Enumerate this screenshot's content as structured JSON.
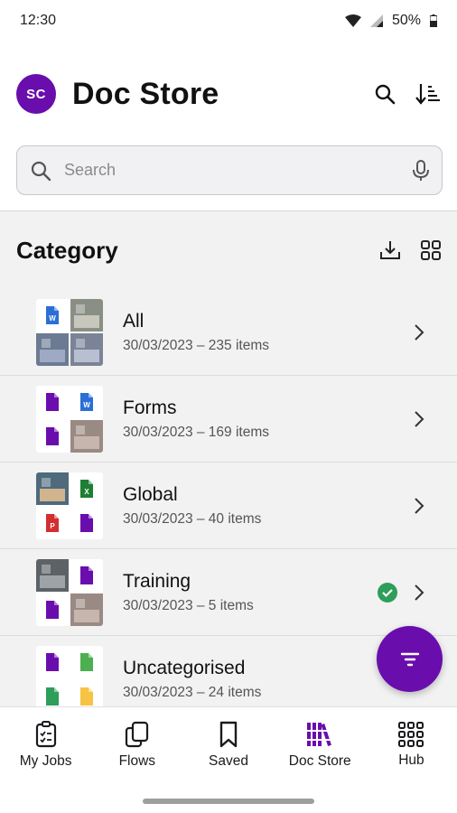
{
  "status_bar": {
    "time": "12:30",
    "battery": "50%"
  },
  "header": {
    "avatar_initials": "SC",
    "title": "Doc Store"
  },
  "search": {
    "placeholder": "Search"
  },
  "section": {
    "title": "Category"
  },
  "categories": [
    {
      "name": "All",
      "meta": "30/03/2023 – 235 items",
      "thumbs": [
        "word",
        "photo-room",
        "photo-office",
        "photo-office2"
      ],
      "checked": false
    },
    {
      "name": "Forms",
      "meta": "30/03/2023 – 169 items",
      "thumbs": [
        "pdf",
        "word",
        "pdf",
        "photo-people"
      ],
      "checked": false
    },
    {
      "name": "Global",
      "meta": "30/03/2023 – 40 items",
      "thumbs": [
        "photo-group",
        "excel",
        "powerpoint",
        "pdf"
      ],
      "checked": false
    },
    {
      "name": "Training",
      "meta": "30/03/2023 – 5 items",
      "thumbs": [
        "photo-machine",
        "pdf",
        "pdf",
        "photo-people"
      ],
      "checked": true
    },
    {
      "name": "Uncategorised",
      "meta": "30/03/2023 – 24 items",
      "thumbs": [
        "pdf",
        "file-green",
        "file-green2",
        "file-yellow"
      ],
      "checked": false
    }
  ],
  "bottom_nav": [
    {
      "label": "My Jobs",
      "icon": "clipboard-icon"
    },
    {
      "label": "Flows",
      "icon": "flows-icon"
    },
    {
      "label": "Saved",
      "icon": "bookmark-icon"
    },
    {
      "label": "Doc Store",
      "icon": "library-icon",
      "active": true
    },
    {
      "label": "Hub",
      "icon": "grid-icon"
    }
  ],
  "colors": {
    "accent": "#6a0dad",
    "pdf": "#6a0dad",
    "word": "#2b6fd6",
    "excel": "#1e7e34",
    "ppt": "#d32f2f",
    "check": "#2e9e5b"
  }
}
